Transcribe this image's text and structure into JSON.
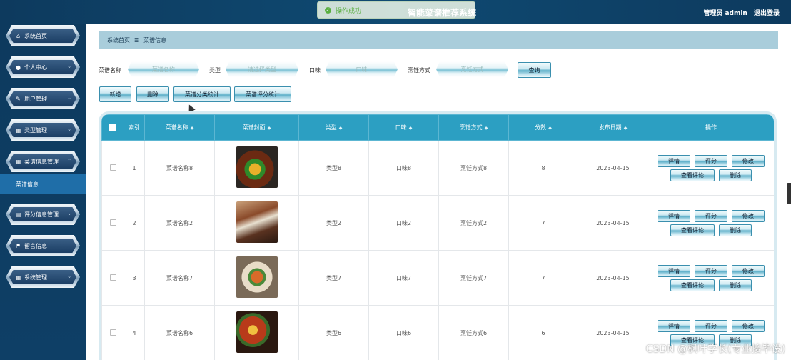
{
  "header": {
    "app_title": "智能菜谱推荐系统",
    "toast": "操作成功",
    "user_label": "管理员 admin",
    "logout": "退出登录"
  },
  "sidebar": {
    "items": [
      {
        "label": "系统首页",
        "icon": "home-icon"
      },
      {
        "label": "个人中心",
        "icon": "user-icon"
      },
      {
        "label": "用户管理",
        "icon": "edit-icon"
      },
      {
        "label": "类型管理",
        "icon": "grid-icon"
      },
      {
        "label": "菜谱信息管理",
        "icon": "grid-icon"
      },
      {
        "label": "评分信息管理",
        "icon": "chat-icon"
      },
      {
        "label": "留言信息",
        "icon": "flag-icon"
      },
      {
        "label": "系统管理",
        "icon": "grid-icon"
      }
    ],
    "active_sub": "菜谱信息"
  },
  "breadcrumb": {
    "home": "系统首页",
    "sep": "☰",
    "current": "菜谱信息"
  },
  "search": {
    "name_label": "菜谱名称",
    "name_placeholder": "菜谱名称",
    "type_label": "类型",
    "type_placeholder": "请选择类型",
    "taste_label": "口味",
    "taste_placeholder": "口味",
    "method_label": "烹饪方式",
    "method_placeholder": "烹饪方式",
    "query_button": "查询"
  },
  "toolbar": {
    "add": "新增",
    "delete": "删除",
    "category_stats": "菜谱分类统计",
    "rating_stats": "菜谱评分统计"
  },
  "table": {
    "columns": [
      "索引",
      "菜谱名称",
      "菜谱封面",
      "类型",
      "口味",
      "烹饪方式",
      "分数",
      "发布日期",
      "操作"
    ],
    "rows": [
      {
        "index": "1",
        "name": "菜谱名称8",
        "type": "类型8",
        "taste": "口味8",
        "method": "烹饪方式8",
        "score": "8",
        "date": "2023-04-15",
        "cover_color": "#3b2a22"
      },
      {
        "index": "2",
        "name": "菜谱名称2",
        "type": "类型2",
        "taste": "口味2",
        "method": "烹饪方式2",
        "score": "7",
        "date": "2023-04-15",
        "cover_color": "#6a3d28"
      },
      {
        "index": "3",
        "name": "菜谱名称7",
        "type": "类型7",
        "taste": "口味7",
        "method": "烹饪方式7",
        "score": "7",
        "date": "2023-04-15",
        "cover_color": "#8a6a4e"
      },
      {
        "index": "4",
        "name": "菜谱名称6",
        "type": "类型6",
        "taste": "口味6",
        "method": "烹饪方式6",
        "score": "6",
        "date": "2023-04-15",
        "cover_color": "#4a2a20"
      }
    ],
    "ops": {
      "detail": "详情",
      "rate": "评分",
      "edit": "修改",
      "view_comments": "查看评论",
      "delete": "删除"
    }
  },
  "watermark": "CSDN @枫叶学长(专业接毕设)"
}
